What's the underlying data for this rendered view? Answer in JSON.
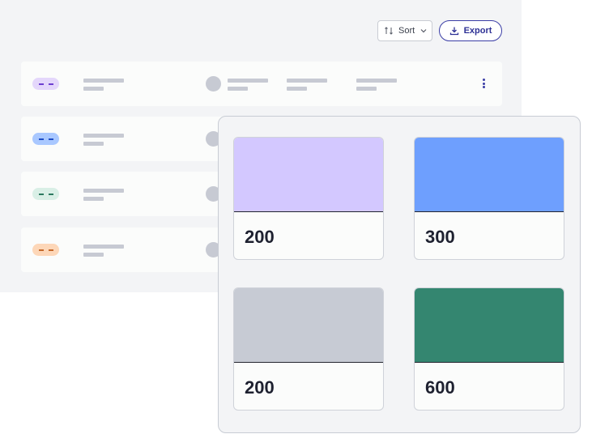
{
  "toolbar": {
    "sort_label": "Sort",
    "export_label": "Export"
  },
  "rows": [
    {
      "pill_color": "#e4d7fb",
      "pill_dash": "#6e3fd1"
    },
    {
      "pill_color": "#a9c8ff",
      "pill_dash": "#1f4fc7"
    },
    {
      "pill_color": "#d9efe6",
      "pill_dash": "#2c7a60"
    },
    {
      "pill_color": "#fdd7b8",
      "pill_dash": "#c56a2a"
    }
  ],
  "swatches": [
    {
      "value": "200",
      "color": "#d3c8ff"
    },
    {
      "value": "300",
      "color": "#6e9ffe"
    },
    {
      "value": "200",
      "color": "#c7cbd4"
    },
    {
      "value": "600",
      "color": "#348670"
    }
  ]
}
